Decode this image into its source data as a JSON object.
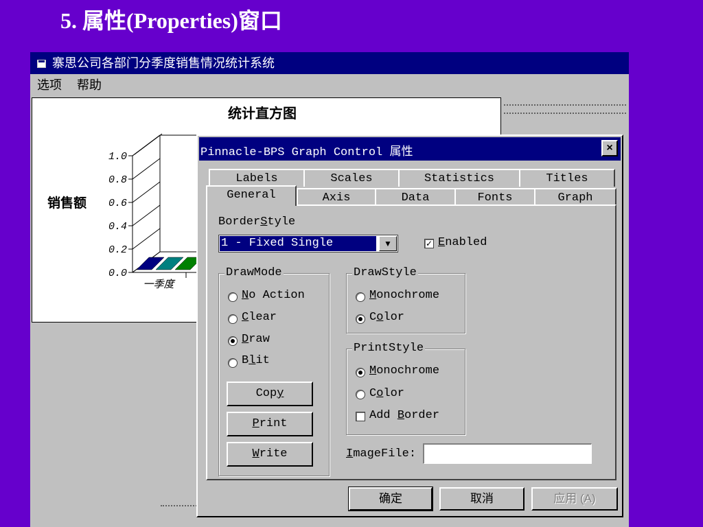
{
  "slide": {
    "title": "5. 属性(Properties)窗口"
  },
  "app": {
    "title": "寨思公司各部门分季度销售情况统计系统",
    "menu": {
      "options": "选项",
      "help": "帮助"
    }
  },
  "chart_data": {
    "type": "bar",
    "title": "统计直方图",
    "ylabel": "销售额",
    "xlabel": "",
    "ylim": [
      0,
      1.0
    ],
    "yticks": [
      "1.0",
      "0.8",
      "0.6",
      "0.4",
      "0.2",
      "0.0"
    ],
    "categories": [
      "一季度"
    ],
    "series_colors": [
      "#000080",
      "#008080",
      "#008000"
    ]
  },
  "dialog": {
    "title": "Pinnacle-BPS Graph Control 属性",
    "close": "×",
    "tabs_back": [
      "Labels",
      "Scales",
      "Statistics",
      "Titles"
    ],
    "tabs_front": [
      "General",
      "Axis",
      "Data",
      "Fonts",
      "Graph"
    ],
    "border_style": {
      "label_pre": "Border",
      "label_u": "S",
      "label_post": "tyle",
      "value": "1 - Fixed Single",
      "arrow": "▼"
    },
    "enabled": {
      "pre": "",
      "u": "E",
      "post": "nabled",
      "checked": true,
      "mark": "✓"
    },
    "draw_mode": {
      "title": "DrawMode",
      "options": [
        {
          "pre": "",
          "u": "N",
          "post": "o Action",
          "checked": false
        },
        {
          "pre": "",
          "u": "C",
          "post": "lear",
          "checked": false
        },
        {
          "pre": "",
          "u": "D",
          "post": "raw",
          "checked": true
        },
        {
          "pre": "B",
          "u": "l",
          "post": "it",
          "checked": false
        }
      ]
    },
    "draw_style": {
      "title": "DrawStyle",
      "options": [
        {
          "pre": "",
          "u": "M",
          "post": "onochrome",
          "checked": false
        },
        {
          "pre": "C",
          "u": "o",
          "post": "lor",
          "checked": true
        }
      ]
    },
    "print_style": {
      "title": "PrintStyle",
      "options": [
        {
          "pre": "",
          "u": "M",
          "post": "onochrome",
          "checked": true
        },
        {
          "pre": "C",
          "u": "o",
          "post": "lor",
          "checked": false
        }
      ],
      "add_border": {
        "pre": "Add ",
        "u": "B",
        "post": "order",
        "checked": false
      }
    },
    "buttons": {
      "copy": {
        "pre": "Cop",
        "u": "y",
        "post": ""
      },
      "print": {
        "pre": "",
        "u": "P",
        "post": "rint"
      },
      "write": {
        "pre": "",
        "u": "W",
        "post": "rite"
      }
    },
    "image_file": {
      "pre": "",
      "u": "I",
      "post": "mageFile:",
      "value": ""
    },
    "footer": {
      "ok": "确定",
      "cancel": "取消",
      "apply": "应用 (A)"
    }
  }
}
